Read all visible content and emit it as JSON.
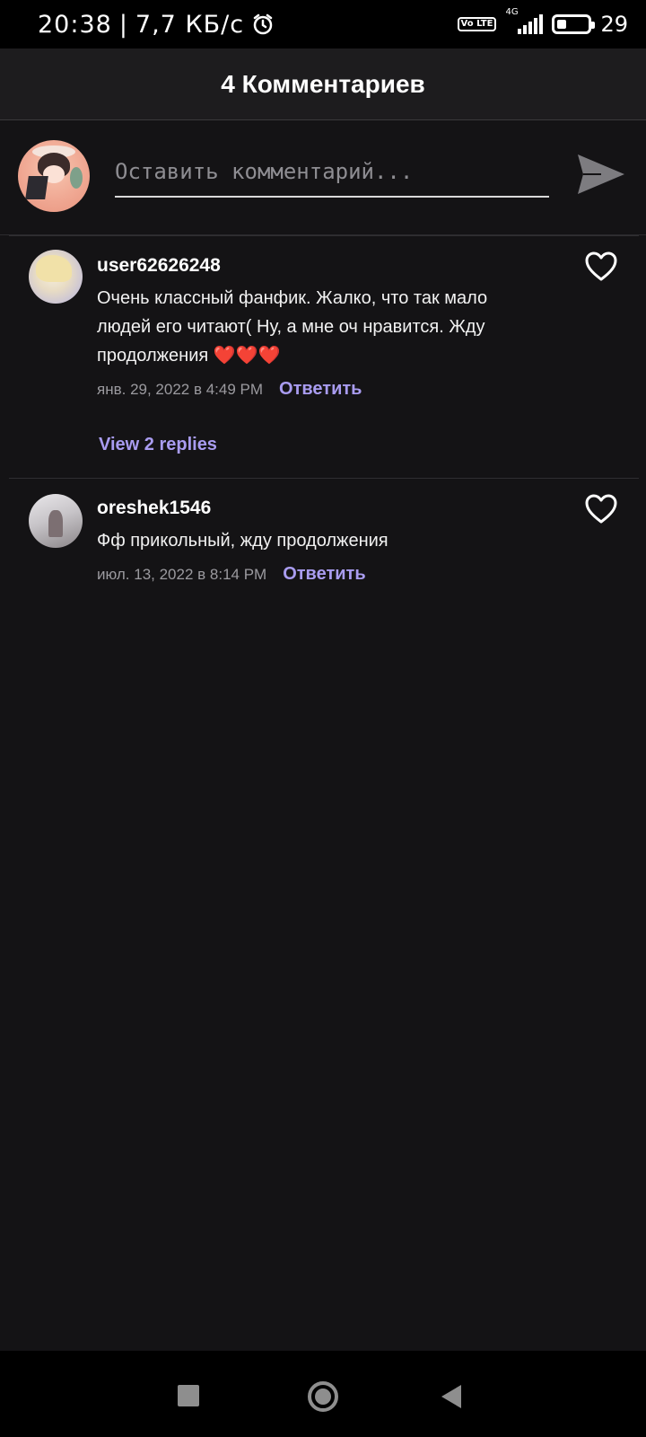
{
  "status_bar": {
    "time": "20:38",
    "separator": "|",
    "speed": "7,7 КБ/с",
    "volte": "Vo LTE",
    "network": "4G",
    "battery": "29",
    "battery_level": 0.29,
    "icons": [
      "alarm-icon",
      "volte-icon",
      "signal-icon",
      "battery-icon"
    ]
  },
  "header": {
    "title": "4 Комментариев"
  },
  "composer": {
    "placeholder": "Оставить комментарий...",
    "value": "",
    "send_icon": "send-icon"
  },
  "comments": [
    {
      "username": "user62626248",
      "text": "Очень классный фанфик. Жалко, что так мало людей его читают( Ну, а мне оч нравится. Жду продолжения ❤️❤️❤️",
      "date": "янв. 29, 2022 в 4:49 PM",
      "reply_label": "Ответить",
      "replies_label": "View 2 replies",
      "like_icon": "heart-outline-icon"
    },
    {
      "username": "oreshek1546",
      "text": "Фф прикольный, жду продолжения",
      "date": "июл. 13, 2022 в 8:14 PM",
      "reply_label": "Ответить",
      "like_icon": "heart-outline-icon"
    }
  ],
  "nav_bar": {
    "icons": [
      "recent-apps-icon",
      "home-icon",
      "back-icon"
    ]
  },
  "colors": {
    "background": "#141315",
    "header_background": "#1d1c1e",
    "accent": "#a99cf0",
    "meta_text": "#9b9a9f",
    "nav_icon": "#8e8e8e"
  }
}
